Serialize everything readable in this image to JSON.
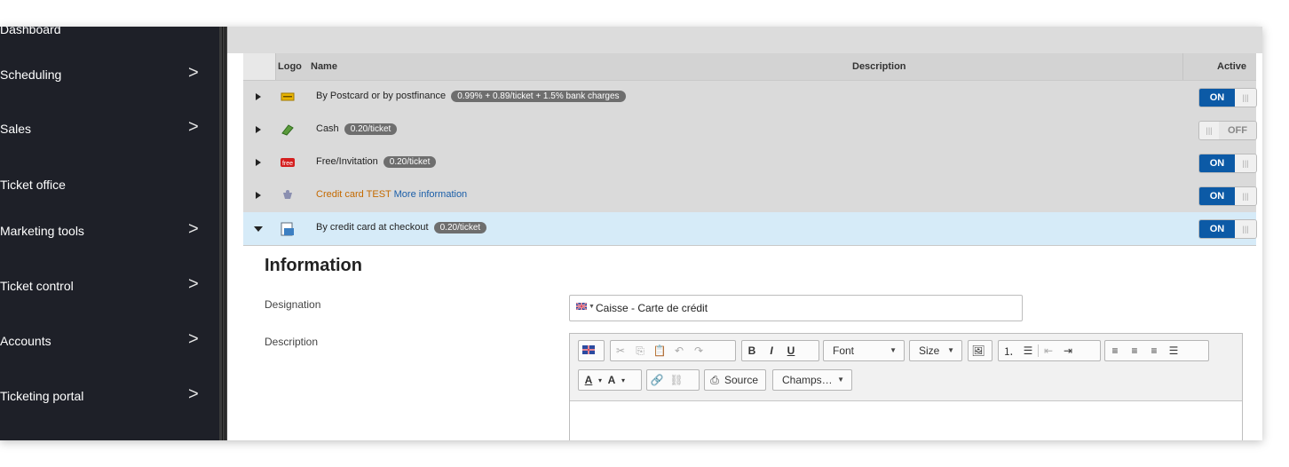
{
  "sidebar": {
    "items": [
      {
        "label": "Dashboard",
        "chevron": ""
      },
      {
        "label": "Scheduling",
        "chevron": ">"
      },
      {
        "label": "Sales",
        "chevron": ">"
      },
      {
        "label": "Ticket office",
        "chevron": ""
      },
      {
        "label": "Marketing tools",
        "chevron": ">"
      },
      {
        "label": "Ticket control",
        "chevron": ">"
      },
      {
        "label": "Accounts",
        "chevron": ">"
      },
      {
        "label": "Ticketing portal",
        "chevron": ">"
      }
    ]
  },
  "table": {
    "headers": {
      "logo": "Logo",
      "name": "Name",
      "description": "Description",
      "active": "Active"
    },
    "rows": [
      {
        "name": "By Postcard or by postfinance",
        "badge": "0.99% + 0.89/ticket + 1.5% bank charges",
        "active": "ON",
        "icon": "postcard-icon"
      },
      {
        "name": "Cash",
        "badge": "0.20/ticket",
        "active": "OFF",
        "icon": "cash-icon"
      },
      {
        "name": "Free/Invitation",
        "badge": "0.20/ticket",
        "active": "ON",
        "icon": "free-icon"
      },
      {
        "name": "Credit card TEST",
        "link": "More information",
        "active": "ON",
        "icon": "card-test-icon"
      },
      {
        "name": "By credit card at checkout",
        "badge": "0.20/ticket",
        "active": "ON",
        "icon": "checkout-card-icon"
      }
    ],
    "toggle_off_label": "OFF",
    "toggle_knob": "|||"
  },
  "detail": {
    "title": "Information",
    "designation_label": "Designation",
    "designation_value": "Caisse - Carte de crédit",
    "description_label": "Description",
    "toolbar": {
      "bold": "B",
      "italic": "I",
      "underline": "U",
      "font": "Font",
      "size": "Size",
      "source": "Source",
      "fields": "Champs…",
      "text_color": "A",
      "bg_color": "A"
    }
  },
  "colors": {
    "sidebar_bg": "#1e2028",
    "toggle_on": "#0c5aa6",
    "selected_row": "#d6ebf8",
    "badge": "#6e6e6e"
  }
}
